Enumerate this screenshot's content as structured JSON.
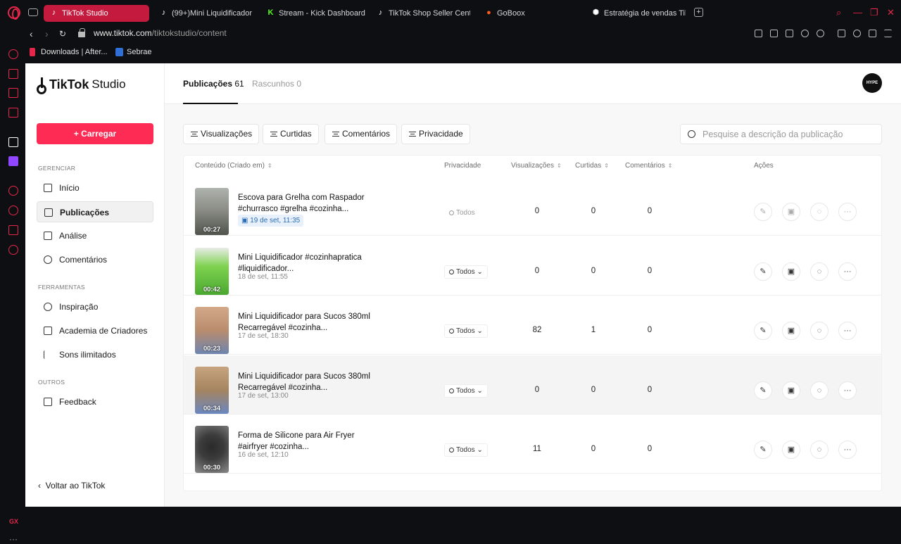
{
  "browser": {
    "tabs": [
      {
        "title": "TikTok Studio",
        "active": true,
        "icon": "tiktok-icon"
      },
      {
        "title": "(99+)Mini Liquidificador #",
        "active": false,
        "icon": "tiktok-icon"
      },
      {
        "title": "Stream - Kick Dashboard",
        "active": false,
        "icon": "kick-icon"
      },
      {
        "title": "TikTok Shop Seller Cente",
        "active": false,
        "icon": "tiktok-icon"
      },
      {
        "title": "GoBoox",
        "active": false,
        "icon": "goboox-icon"
      },
      {
        "title": "Estratégia de vendas TikT",
        "active": false,
        "icon": "openai-icon"
      }
    ],
    "url_host": "www.tiktok.com",
    "url_path": "/tiktokstudio/content",
    "bookmarks": [
      {
        "label": "Downloads | After..."
      },
      {
        "label": "Sebrae"
      }
    ]
  },
  "brand": {
    "name": "TikTok",
    "sub": "Studio"
  },
  "upload_label": "+ Carregar",
  "nav": {
    "section_manage": "GERENCIAR",
    "section_tools": "FERRAMENTAS",
    "section_others": "OUTROS",
    "inicio": "Início",
    "publicacoes": "Publicações",
    "analise": "Análise",
    "comentarios": "Comentários",
    "inspiracao": "Inspiração",
    "academia": "Academia de Criadores",
    "sons": "Sons ilimitados",
    "feedback": "Feedback",
    "back": "Voltar ao TikTok"
  },
  "main_tabs": {
    "pub_label": "Publicações",
    "pub_count": "61",
    "drafts_label": "Rascunhos",
    "drafts_count": "0"
  },
  "avatar_text": "HYPE",
  "filters": [
    "Visualizações",
    "Curtidas",
    "Comentários",
    "Privacidade"
  ],
  "search_placeholder": "Pesquise a descrição da publicação",
  "columns": {
    "content": "Conteúdo (Criado em)",
    "privacy": "Privacidade",
    "views": "Visualizações",
    "likes": "Curtidas",
    "comments": "Comentários",
    "actions": "Ações"
  },
  "rows": [
    {
      "title": "Escova para Grelha com Raspador #churrasco #grelha #cozinha...",
      "date": "19 de set, 11:35",
      "scheduled": true,
      "duration": "00:27",
      "privacy": "Todos",
      "views": "0",
      "likes": "0",
      "comments": "0"
    },
    {
      "title": "Mini Liquidificador #cozinhapratica #liquidificador...",
      "date": "18 de set, 11:55",
      "scheduled": false,
      "duration": "00:42",
      "privacy": "Todos",
      "views": "0",
      "likes": "0",
      "comments": "0"
    },
    {
      "title": "Mini Liquidificador para Sucos 380ml Recarregável #cozinha...",
      "date": "17 de set, 18:30",
      "scheduled": false,
      "duration": "00:23",
      "privacy": "Todos",
      "views": "82",
      "likes": "1",
      "comments": "0"
    },
    {
      "title": "Mini Liquidificador para Sucos 380ml Recarregável #cozinha...",
      "date": "17 de set, 13:00",
      "scheduled": false,
      "duration": "00:34",
      "privacy": "Todos",
      "views": "0",
      "likes": "0",
      "comments": "0"
    },
    {
      "title": "Forma de Silicone para Air Fryer #airfryer #cozinha...",
      "date": "16 de set, 12:10",
      "scheduled": false,
      "duration": "00:30",
      "privacy": "Todos",
      "views": "11",
      "likes": "0",
      "comments": "0"
    }
  ],
  "colors": {
    "accent": "#fe2c55",
    "browser_accent": "#e6274a"
  }
}
